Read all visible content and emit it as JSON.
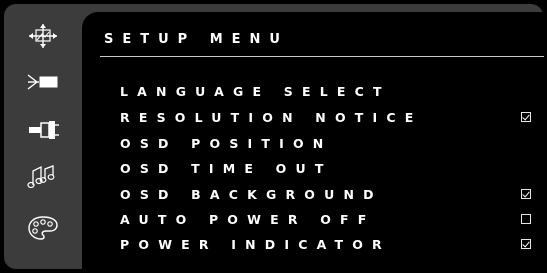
{
  "title": "SETUP MENU",
  "rail_icons": [
    {
      "name": "move-arrows-icon"
    },
    {
      "name": "input-source-icon"
    },
    {
      "name": "connector-icon"
    },
    {
      "name": "audio-icon"
    },
    {
      "name": "palette-icon"
    }
  ],
  "menu_items": [
    {
      "label": "LANGUAGE SELECT",
      "checkbox": "none"
    },
    {
      "label": "RESOLUTION NOTICE",
      "checkbox": "checked"
    },
    {
      "label": "OSD POSITION",
      "checkbox": "none"
    },
    {
      "label": "OSD TIME OUT",
      "checkbox": "none"
    },
    {
      "label": "OSD BACKGROUND",
      "checkbox": "checked"
    },
    {
      "label": "AUTO POWER OFF",
      "checkbox": "unchecked"
    },
    {
      "label": "POWER INDICATOR",
      "checkbox": "checked"
    }
  ]
}
